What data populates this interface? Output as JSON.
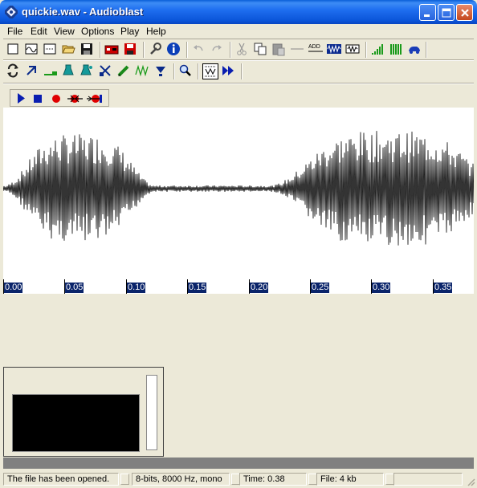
{
  "window": {
    "title": "quickie.wav - Audioblast"
  },
  "menu": [
    "File",
    "Edit",
    "View",
    "Options",
    "Play",
    "Help"
  ],
  "ruler": {
    "labels": [
      "0.00",
      "0.05",
      "0.10",
      "0.15",
      "0.20",
      "0.25",
      "0.30",
      "0.35"
    ]
  },
  "status": {
    "message": "The file has been opened.",
    "format": "8-bits, 8000 Hz, mono",
    "time": "Time: 0.38",
    "file_size": "File: 4 kb"
  }
}
